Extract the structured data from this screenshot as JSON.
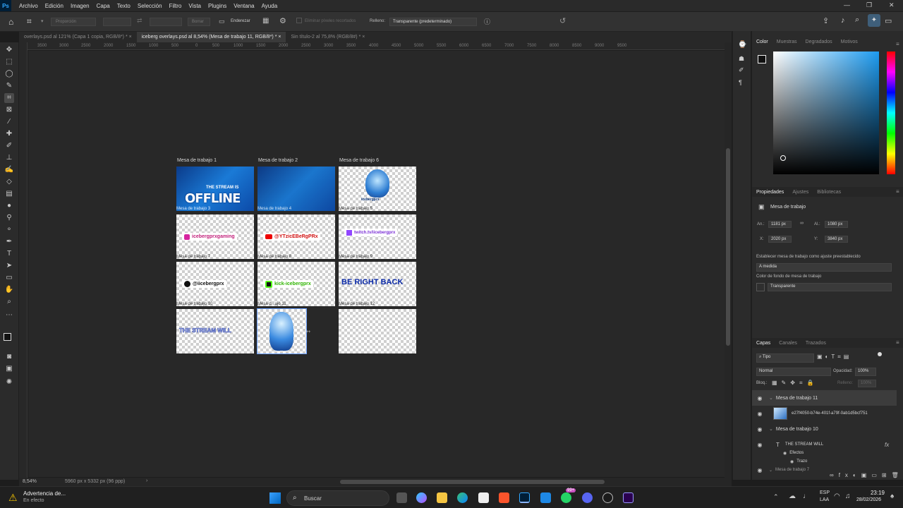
{
  "menu": {
    "logo": "Ps",
    "items": [
      "Archivo",
      "Edición",
      "Imagen",
      "Capa",
      "Texto",
      "Selección",
      "Filtro",
      "Vista",
      "Plugins",
      "Ventana",
      "Ayuda"
    ]
  },
  "options": {
    "ratio_label": "Proporción",
    "clear_label": "Borrar",
    "straighten_label": "Enderezar",
    "delete_pixels_label": "Eliminar píxeles recortados",
    "fill_label": "Relleno:",
    "fill_value": "Transparente (predeterminado)"
  },
  "tabs": [
    "overlays.psd al 121% (Capa 1 copia, RGB/8*) *",
    "iceberg overlays.psd al 8,54% (Mesa de trabajo 11, RGB/8*) *",
    "Sin título-2 al 75,8% (RGB/8#) *"
  ],
  "ruler": [
    "3500",
    "3000",
    "2500",
    "2000",
    "1500",
    "1000",
    "500",
    "0",
    "500",
    "1000",
    "1500",
    "2000",
    "2500",
    "3000",
    "3500",
    "4000",
    "4500",
    "5000",
    "5500",
    "6000",
    "6500",
    "7000",
    "7500",
    "8000",
    "8500",
    "9000",
    "9500"
  ],
  "artboards": {
    "top_labels": [
      "Mesa de trabajo 1",
      "Mesa de trabajo 2",
      "Mesa de trabajo 6"
    ],
    "inner_labels": [
      "Mesa de trabajo 3",
      "Mesa de trabajo 4",
      "Mesa de trabajo 5",
      "Mesa de trabajo 7",
      "Mesa de trabajo 8",
      "Mesa de trabajo 9",
      "Mesa de trabajo 10",
      "Mesa d...ajo 11",
      "Mesa de trabajo 12"
    ],
    "offline_top": "THE STREAM IS",
    "offline_big": "OFFLINE",
    "emote_name": "icebergprx",
    "instagram": "icebergprxgaming",
    "youtube": "@YTzicEBeRgPRx",
    "twitch": "twitch.tv/iicebergprx",
    "tiktok": "@iicebergprx",
    "kick": "kick-icebergprx",
    "brb": "BE RIGHT BACK",
    "stream_will": "THE STREAM WILL"
  },
  "status": {
    "zoom": "8,54%",
    "doc": "5960 px x 5332 px (96 ppp)"
  },
  "color_panel": {
    "tabs": [
      "Color",
      "Muestras",
      "Degradados",
      "Motivos"
    ]
  },
  "properties": {
    "tabs": [
      "Propiedades",
      "Ajustes",
      "Bibliotecas"
    ],
    "type": "Mesa de trabajo",
    "an_label": "An.:",
    "an": "1181 px",
    "al_label": "Al.:",
    "al": "1080 px",
    "x_label": "X:",
    "x": "2020 px",
    "y_label": "Y:",
    "y": "3840 px",
    "preset_label": "Establecer mesa de trabajo como ajuste preestablecido",
    "preset_value": "A medida",
    "bg_label": "Color de fondo de mesa de trabajo",
    "bg_value": "Transparente"
  },
  "layers": {
    "tabs": [
      "Capas",
      "Canales",
      "Trazados"
    ],
    "filter": "Tipo",
    "blend": "Normal",
    "opacity_label": "Opacidad:",
    "opacity": "100%",
    "lock_label": "Bloq.:",
    "fill_label": "Relleno:",
    "fill": "100%",
    "items": [
      "Mesa de trabajo 11",
      "e27f4050-b74e-401f-a79f-0ab1d5bcf751",
      "Mesa de trabajo 10",
      "THE STREAM WILL",
      "Efectos",
      "Trazo",
      "Mesa de trabajo 7"
    ]
  },
  "taskbar": {
    "warning_title": "Advertencia de...",
    "warning_sub": "En efecto",
    "search": "Buscar",
    "lang1": "ESP",
    "lang2": "LAA",
    "time": "23:19",
    "date": "28/02/2026",
    "badge": "99+"
  }
}
